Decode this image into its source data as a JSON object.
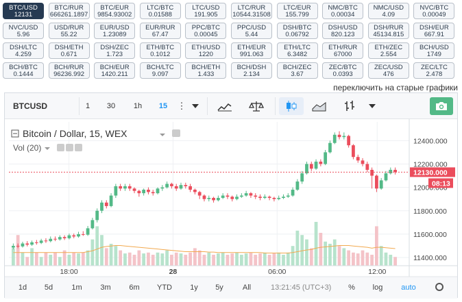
{
  "pairs": [
    {
      "name": "BTC/USD",
      "value": "12131",
      "active": true
    },
    {
      "name": "BTC/RUR",
      "value": "666261.1897"
    },
    {
      "name": "BTC/EUR",
      "value": "9854.93002"
    },
    {
      "name": "LTC/BTC",
      "value": "0.01588"
    },
    {
      "name": "LTC/USD",
      "value": "191.905"
    },
    {
      "name": "LTC/RUR",
      "value": "10544.31508"
    },
    {
      "name": "LTC/EUR",
      "value": "155.799"
    },
    {
      "name": "NMC/BTC",
      "value": "0.00034"
    },
    {
      "name": "NMC/USD",
      "value": "4.09"
    },
    {
      "name": "NVC/BTC",
      "value": "0.00049"
    },
    {
      "name": "NVC/USD",
      "value": "5.96"
    },
    {
      "name": "USD/RUR",
      "value": "55.22"
    },
    {
      "name": "EUR/USD",
      "value": "1.23089"
    },
    {
      "name": "EUR/RUR",
      "value": "67.47"
    },
    {
      "name": "PPC/BTC",
      "value": "0.00045"
    },
    {
      "name": "PPC/USD",
      "value": "5.44"
    },
    {
      "name": "DSH/BTC",
      "value": "0.06792"
    },
    {
      "name": "DSH/USD",
      "value": "820.123"
    },
    {
      "name": "DSH/RUR",
      "value": "45134.815"
    },
    {
      "name": "DSH/EUR",
      "value": "667.91"
    },
    {
      "name": "DSH/LTC",
      "value": "4.259"
    },
    {
      "name": "DSH/ETH",
      "value": "0.671"
    },
    {
      "name": "DSH/ZEC",
      "value": "1.723"
    },
    {
      "name": "ETH/BTC",
      "value": "0.1012"
    },
    {
      "name": "ETH/USD",
      "value": "1220"
    },
    {
      "name": "ETH/EUR",
      "value": "991.063"
    },
    {
      "name": "ETH/LTC",
      "value": "6.3482"
    },
    {
      "name": "ETH/RUR",
      "value": "67000"
    },
    {
      "name": "ETH/ZEC",
      "value": "2.554"
    },
    {
      "name": "BCH/USD",
      "value": "1749"
    },
    {
      "name": "BCH/BTC",
      "value": "0.1444"
    },
    {
      "name": "BCH/RUR",
      "value": "96236.992"
    },
    {
      "name": "BCH/EUR",
      "value": "1420.211"
    },
    {
      "name": "BCH/LTC",
      "value": "9.097"
    },
    {
      "name": "BCH/ETH",
      "value": "1.433"
    },
    {
      "name": "BCH/DSH",
      "value": "2.134"
    },
    {
      "name": "BCH/ZEC",
      "value": "3.67"
    },
    {
      "name": "ZEC/BTC",
      "value": "0.0393"
    },
    {
      "name": "ZEC/USD",
      "value": "476"
    },
    {
      "name": "ZEC/LTC",
      "value": "2.478"
    }
  ],
  "switch_link": "переключить на старые графики",
  "toolbar": {
    "symbol": "BTCUSD",
    "intervals": [
      "1",
      "30",
      "1h",
      "15"
    ],
    "active_interval": "15"
  },
  "legend": {
    "title": "Bitcoin / Dollar, 15, WEX",
    "vol": "Vol (20)"
  },
  "bottom": {
    "ranges": [
      "1d",
      "5d",
      "1m",
      "3m",
      "6m",
      "YTD",
      "1y",
      "5y",
      "All"
    ],
    "time": "13:21:45 (UTC+3)",
    "percent": "%",
    "log": "log",
    "auto": "auto"
  },
  "colors": {
    "up": "#53b987",
    "down": "#eb4d5c",
    "accent": "#2196f3",
    "active_pair": "#263a52"
  },
  "chart_data": {
    "type": "candlestick",
    "price_ticks": [
      "12400.000",
      "12200.000",
      "12000.000",
      "11800.000",
      "11600.000",
      "11400.000"
    ],
    "time_ticks": [
      "18:00",
      "28",
      "06:00",
      "12:00"
    ],
    "last_price": "12130.000",
    "countdown": "08:13",
    "ylim": [
      11330,
      12560
    ],
    "candles": [
      [
        11485,
        11500,
        11520,
        11470
      ],
      [
        11500,
        11495,
        11520,
        11480
      ],
      [
        11495,
        11520,
        11535,
        11485
      ],
      [
        11520,
        11510,
        11540,
        11495
      ],
      [
        11510,
        11530,
        11545,
        11500
      ],
      [
        11530,
        11525,
        11550,
        11510
      ],
      [
        11525,
        11545,
        11560,
        11515
      ],
      [
        11545,
        11540,
        11565,
        11525
      ],
      [
        11540,
        11560,
        11580,
        11530
      ],
      [
        11560,
        11555,
        11580,
        11540
      ],
      [
        11555,
        11575,
        11590,
        11545
      ],
      [
        11575,
        11565,
        11590,
        11550
      ],
      [
        11565,
        11590,
        11605,
        11555
      ],
      [
        11590,
        11580,
        11605,
        11565
      ],
      [
        11580,
        11600,
        11620,
        11570
      ],
      [
        11600,
        11595,
        11625,
        11585
      ],
      [
        11595,
        11650,
        11670,
        11585
      ],
      [
        11650,
        11720,
        11740,
        11640
      ],
      [
        11720,
        11800,
        11820,
        11700
      ],
      [
        11800,
        11870,
        11890,
        11780
      ],
      [
        11870,
        11840,
        11890,
        11820
      ],
      [
        11840,
        11930,
        11950,
        11830
      ],
      [
        11930,
        12010,
        12030,
        11910
      ],
      [
        12010,
        11990,
        12030,
        11970
      ],
      [
        11990,
        12010,
        12030,
        11970
      ],
      [
        12010,
        11990,
        12030,
        11970
      ],
      [
        11990,
        11970,
        12000,
        11950
      ],
      [
        11970,
        11950,
        11980,
        11920
      ],
      [
        11950,
        11980,
        11990,
        11930
      ],
      [
        11980,
        11960,
        12000,
        11940
      ],
      [
        11960,
        11950,
        11980,
        11930
      ],
      [
        11950,
        11990,
        12000,
        11940
      ],
      [
        11990,
        12000,
        12020,
        11970
      ],
      [
        12000,
        12030,
        12050,
        11990
      ],
      [
        12030,
        12010,
        12040,
        11990
      ],
      [
        12010,
        11990,
        12030,
        11970
      ],
      [
        11990,
        12020,
        12040,
        11980
      ],
      [
        12020,
        12010,
        12040,
        11990
      ],
      [
        12010,
        11980,
        12030,
        11960
      ],
      [
        11980,
        11960,
        11990,
        11940
      ],
      [
        11960,
        11930,
        11970,
        11900
      ],
      [
        11930,
        11900,
        11940,
        11880
      ],
      [
        11900,
        11910,
        11930,
        11880
      ],
      [
        11910,
        11890,
        11920,
        11870
      ],
      [
        11890,
        11910,
        11930,
        11880
      ],
      [
        11910,
        11930,
        11950,
        11900
      ],
      [
        11930,
        11920,
        11950,
        11900
      ],
      [
        11920,
        11900,
        11930,
        11880
      ],
      [
        11900,
        11920,
        11940,
        11890
      ],
      [
        11920,
        11930,
        11950,
        11910
      ],
      [
        11930,
        11950,
        11970,
        11920
      ],
      [
        11950,
        11930,
        11960,
        11910
      ],
      [
        11930,
        11920,
        11950,
        11900
      ],
      [
        11920,
        11910,
        11940,
        11890
      ],
      [
        11910,
        11920,
        11940,
        11900
      ],
      [
        11920,
        11910,
        11930,
        11890
      ],
      [
        11910,
        11900,
        11920,
        11880
      ],
      [
        11900,
        11910,
        11930,
        11890
      ],
      [
        11910,
        11920,
        11940,
        11900
      ],
      [
        11920,
        11930,
        11950,
        11910
      ],
      [
        11930,
        11980,
        12000,
        11920
      ],
      [
        11980,
        12050,
        12070,
        11970
      ],
      [
        12050,
        12120,
        12140,
        12030
      ],
      [
        12120,
        12200,
        12220,
        12110
      ],
      [
        12200,
        12160,
        12220,
        12140
      ],
      [
        12160,
        12220,
        12240,
        12150
      ],
      [
        12220,
        12200,
        12240,
        12180
      ],
      [
        12200,
        12300,
        12320,
        12190
      ],
      [
        12300,
        12380,
        12400,
        12290
      ],
      [
        12380,
        12450,
        12470,
        12370
      ],
      [
        12450,
        12430,
        12480,
        12410
      ],
      [
        12430,
        12440,
        12470,
        12410
      ],
      [
        12440,
        12360,
        12450,
        12340
      ],
      [
        12360,
        12260,
        12370,
        12240
      ],
      [
        12260,
        12230,
        12280,
        12210
      ],
      [
        12230,
        12200,
        12250,
        12180
      ],
      [
        12200,
        12150,
        12220,
        12130
      ],
      [
        12150,
        12100,
        12170,
        11990
      ],
      [
        12100,
        11990,
        12110,
        11960
      ],
      [
        11990,
        12060,
        12080,
        11980
      ],
      [
        12060,
        12120,
        12140,
        12050
      ],
      [
        12120,
        12150,
        12170,
        12110
      ],
      [
        12150,
        12130,
        12170,
        12110
      ]
    ],
    "volume": [
      40,
      70,
      30,
      20,
      40,
      30,
      20,
      30,
      25,
      30,
      20,
      35,
      25,
      30,
      28,
      30,
      35,
      60,
      90,
      70,
      40,
      50,
      45,
      35,
      28,
      30,
      25,
      35,
      28,
      30,
      25,
      30,
      28,
      35,
      25,
      30,
      28,
      25,
      30,
      40,
      35,
      25,
      30,
      25,
      28,
      30,
      25,
      28,
      30,
      25,
      28,
      30,
      25,
      28,
      30,
      25,
      28,
      30,
      25,
      30,
      45,
      80,
      70,
      60,
      40,
      100,
      75,
      55,
      50,
      60,
      45,
      40,
      35,
      30,
      28,
      35,
      30,
      25,
      90,
      45,
      30,
      25,
      20
    ],
    "vol_ma": [
      30,
      30,
      30,
      30,
      30,
      30,
      30,
      30,
      30,
      30,
      30,
      30,
      30,
      30,
      30,
      30,
      32,
      34,
      38,
      42,
      44,
      45,
      46,
      46,
      45,
      44,
      43,
      42,
      41,
      40,
      39,
      38,
      37,
      36,
      35,
      34,
      33,
      32,
      32,
      32,
      32,
      32,
      31,
      31,
      30,
      30,
      30,
      30,
      30,
      30,
      30,
      30,
      30,
      30,
      29,
      29,
      29,
      29,
      29,
      29,
      30,
      32,
      34,
      36,
      37,
      40,
      42,
      43,
      44,
      45,
      46,
      46,
      46,
      45,
      44,
      43,
      42,
      40,
      42,
      42,
      41,
      40,
      39
    ]
  }
}
